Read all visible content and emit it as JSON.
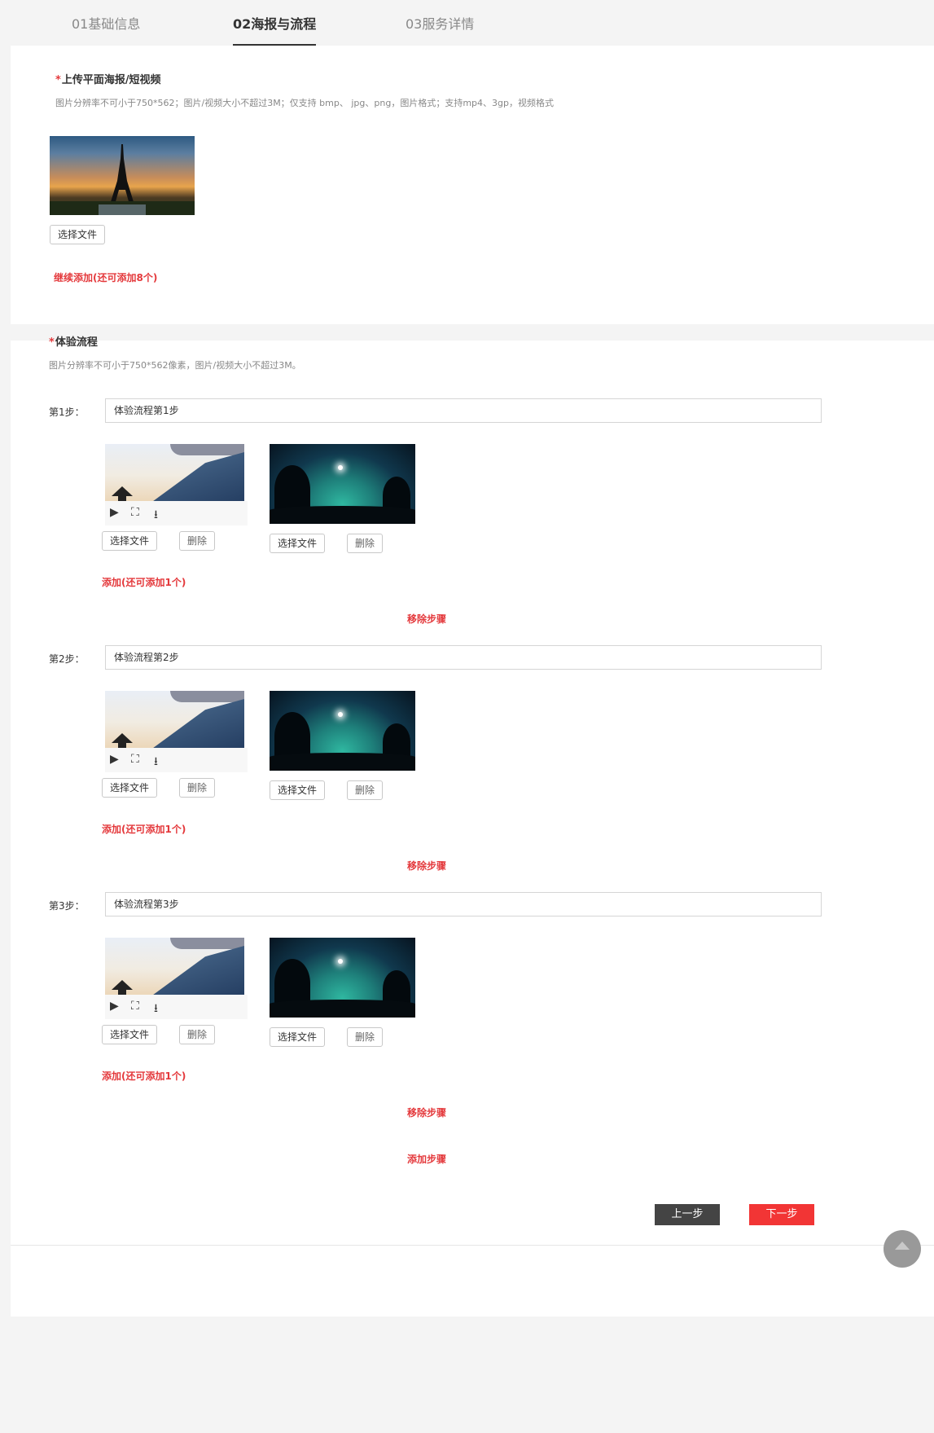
{
  "tabs": [
    {
      "label": "01基础信息"
    },
    {
      "label": "02海报与流程"
    },
    {
      "label": "03服务详情"
    }
  ],
  "poster": {
    "required_mark": "*",
    "title": "上传平面海报/短视频",
    "hint": "图片分辨率不可小于750*562；图片/视频大小不超过3M；仅支持 bmp、 jpg、png，图片格式；支持mp4、3gp，视频格式",
    "choose_label": "选择文件",
    "add_more_label": "继续添加(还可添加8个)"
  },
  "flow": {
    "required_mark": "*",
    "title": "体验流程",
    "hint": "图片分辨率不可小于750*562像素，图片/视频大小不超过3M。",
    "steps": [
      {
        "label": "第1步：",
        "value": "体验流程第1步",
        "choose_label": "选择文件",
        "delete_label": "删除",
        "add_label": "添加(还可添加1个)",
        "remove_label": "移除步骤"
      },
      {
        "label": "第2步：",
        "value": "体验流程第2步",
        "choose_label": "选择文件",
        "delete_label": "删除",
        "add_label": "添加(还可添加1个)",
        "remove_label": "移除步骤"
      },
      {
        "label": "第3步：",
        "value": "体验流程第3步",
        "choose_label": "选择文件",
        "delete_label": "删除",
        "add_label": "添加(还可添加1个)",
        "remove_label": "移除步骤"
      }
    ],
    "add_step_label": "添加步骤"
  },
  "footer": {
    "prev_label": "上一步",
    "next_label": "下一步"
  },
  "video_controls": {
    "play_icon": "▶",
    "fullscreen_icon": "⛶",
    "download_icon": "⭳"
  },
  "colors": {
    "accent": "#e4393c",
    "next_button": "#f23535",
    "prev_button": "#444444"
  }
}
